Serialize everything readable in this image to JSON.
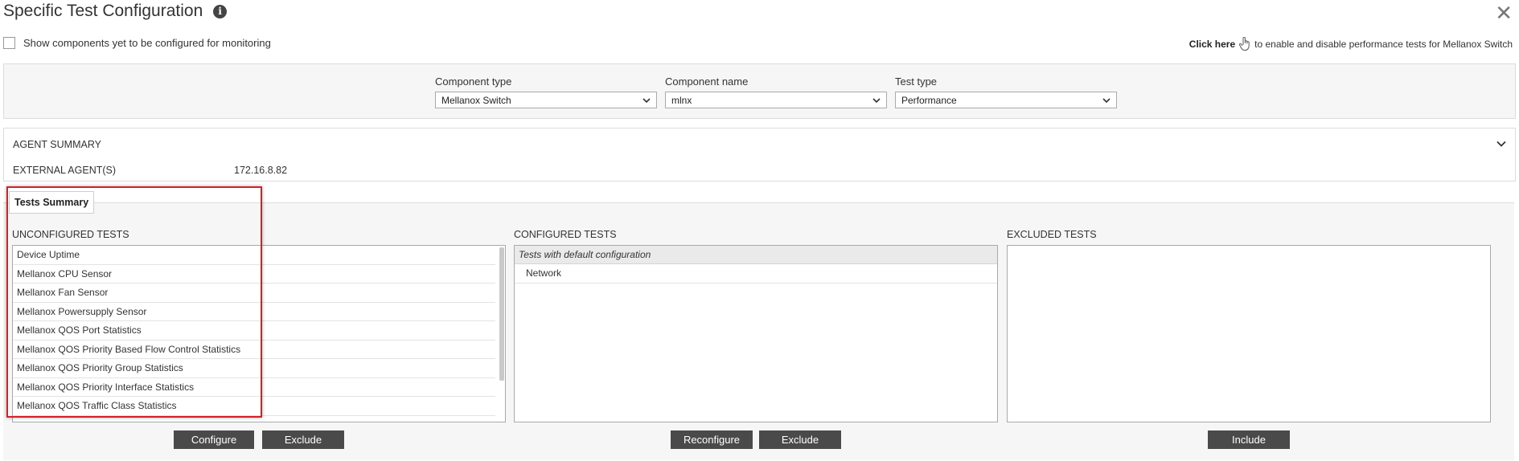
{
  "window": {
    "title": "Specific Test Configuration",
    "info_icon": "info-icon",
    "close_icon": "close-icon"
  },
  "toolbar": {
    "show_unconfigured_label": "Show components yet to be configured for monitoring",
    "click_here_label": "Click here",
    "click_here_suffix": "to enable and disable performance tests for Mellanox Switch"
  },
  "filters": {
    "component_type": {
      "label": "Component type",
      "value": "Mellanox Switch"
    },
    "component_name": {
      "label": "Component name",
      "value": "mlnx"
    },
    "test_type": {
      "label": "Test type",
      "value": "Performance"
    }
  },
  "agent_summary": {
    "title": "AGENT SUMMARY",
    "external_agents_label": "EXTERNAL AGENT(S)",
    "external_agents_value": "172.16.8.82"
  },
  "tests_summary": {
    "tab_label": "Tests Summary",
    "unconfigured": {
      "title": "UNCONFIGURED TESTS",
      "items": [
        "Device Uptime",
        "Mellanox CPU Sensor",
        "Mellanox Fan Sensor",
        "Mellanox Powersupply Sensor",
        "Mellanox QOS Port Statistics",
        "Mellanox QOS Priority Based Flow Control Statistics",
        "Mellanox QOS Priority Group Statistics",
        "Mellanox QOS Priority Interface Statistics",
        "Mellanox QOS Traffic Class Statistics"
      ],
      "configure_label": "Configure",
      "exclude_label": "Exclude"
    },
    "configured": {
      "title": "CONFIGURED TESTS",
      "group_header": "Tests with default configuration",
      "items": [
        "Network"
      ],
      "reconfigure_label": "Reconfigure",
      "exclude_label": "Exclude"
    },
    "excluded": {
      "title": "EXCLUDED TESTS",
      "items": [],
      "include_label": "Include"
    }
  },
  "colors": {
    "highlight": "#d6202a",
    "button_bg": "#4a4a4a",
    "panel_bg": "#f6f6f6"
  }
}
